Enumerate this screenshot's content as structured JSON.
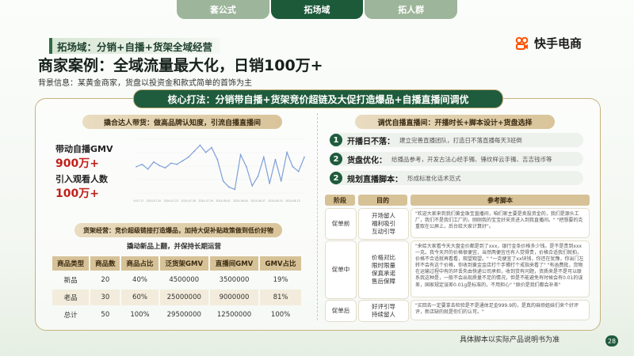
{
  "tabs": [
    "套公式",
    "拓场域",
    "拓人群"
  ],
  "active_tab": 1,
  "section_tag": "拓场域：分销+自播+货架全域经营",
  "title": "商家案例：全域流量最大化，日销100万+",
  "background": "背景信息：某黄金商家，货盘以投资金和款式简单的首饰为主",
  "brand": {
    "name": "快手电商",
    "icon": "kuaishou-logo-icon",
    "color": "#ff5000"
  },
  "core_strategy": "核心打法：分销带自播+货架竞价超链及大促打造爆品+自播直播间调优",
  "left": {
    "pill1": "撬合达人带货：做高品牌认知度，引流自播直播间",
    "stats": [
      {
        "label": "带动自播GMV",
        "value": "900万+"
      },
      {
        "label": "引入观看人数",
        "value": "100万+"
      }
    ],
    "chart_data": {
      "type": "line",
      "title": "",
      "x": [
        "2024-07-17",
        "2024-07-18",
        "2024-07-19",
        "2024-07-20",
        "2024-07-21",
        "2024-07-22",
        "2024-07-23",
        "2024-07-24",
        "2024-07-25",
        "2024-07-26",
        "2024-07-27",
        "2024-07-28",
        "2024-07-29",
        "2024-07-30",
        "2024-07-31",
        "2024-08-01",
        "2024-08-02",
        "2024-08-03",
        "2024-08-04",
        "2024-08-05",
        "2024-08-06",
        "2024-08-07",
        "2024-08-08",
        "2024-08-09",
        "2024-08-10",
        "2024-08-11",
        "2024-08-12",
        "2024-08-13",
        "2024-08-14",
        "2024-08-15"
      ],
      "values": [
        22,
        24,
        20,
        26,
        23,
        21,
        25,
        24,
        27,
        30,
        35,
        40,
        34,
        38,
        28,
        10,
        5,
        3,
        32,
        22,
        6,
        14,
        30,
        8,
        28,
        10,
        34,
        22,
        18,
        30
      ],
      "ylim": [
        0,
        45
      ],
      "color": "#7f9fd9"
    },
    "pill2": "货架经营：竞价超级链接打造爆品，加持大促补贴政策做到低价好物",
    "sub_note": "撬动新品上翻，并保持长期运营",
    "table": {
      "headers": [
        "商品类型",
        "商品数",
        "商品占比",
        "泛货架GMV",
        "直播间GMV",
        "GMV占比"
      ],
      "rows": [
        [
          "新品",
          "20",
          "40%",
          "4500000",
          "3500000",
          "19%"
        ],
        [
          "老品",
          "30",
          "60%",
          "25000000",
          "9000000",
          "81%"
        ],
        [
          "总计",
          "50",
          "100%",
          "29500000",
          "12500000",
          "100%"
        ]
      ]
    }
  },
  "right": {
    "pill": "调优自播直播间：开播时长+脚本设计+货盘选择",
    "steps": [
      {
        "num": "1",
        "title": "开播日不落：",
        "desc": "建立完善直播团队，打造日不落直播每天3班倒"
      },
      {
        "num": "2",
        "title": "货盘优化：",
        "desc": "给播品参考，开发古法心经手镯、锤纹样云手镯、吉吉钱币等"
      },
      {
        "num": "2",
        "title": "规划直播脚本：",
        "desc": "形成标准化话术范式"
      }
    ],
    "headers": [
      "阶段",
      "目的",
      "参考脚本"
    ],
    "rows": [
      {
        "stage": "促单前",
        "purpose": "开场留人\n福利吸引\n互动引导",
        "script": "\"欢迎大家来到我们黄金珠宝直播间，咱们家主要是卖投资金的，我们是源头工厂，我们不是我们工厂的，刚刚我的宝宝好采资进入到我直播间。\" \"把想要的克重取在公屏上，后台给大家计算好\"。"
      },
      {
        "stage": "促单中",
        "purpose": "价格对比\n限时限量\n保真承诺\n售后保障",
        "script": "\"来给大家看今天大盘金价都是到了xxx，银行金条价格多少钱。是不是贵到xxx一克。我今天开的价格很便宜，当然两便宜也有人觉得贵，价格合适我们就拍，价格不合适就再看看，观望观望。\" \"一克便宜了xx块钱，你还在犹豫，你出门左转不会有这个价格，你收到黄金金店打个手镯打个戒指来看了\" \"有函费批，货物在运输过程中有的环丢失由快递公司承担，收到货有问题，资质来是不是可以联系我这种是，一般不会出现质量不足的情况，但是不能避免有时候会有0.01的误差，国家规定误差0.01g是标准的，不用担心\" \"原价是我们都会补差\""
      },
      {
        "stage": "促单后",
        "purpose": "好评引导\n持续留人",
        "script": "\"买回去一定要拿去检验是不是通体足金999.9的，是真的麻烦姐妹们来个好评评，新店缺的就是你们的认可。\""
      }
    ]
  },
  "footnote": "具体脚本以实际产品说明书为准",
  "page_number": "28"
}
